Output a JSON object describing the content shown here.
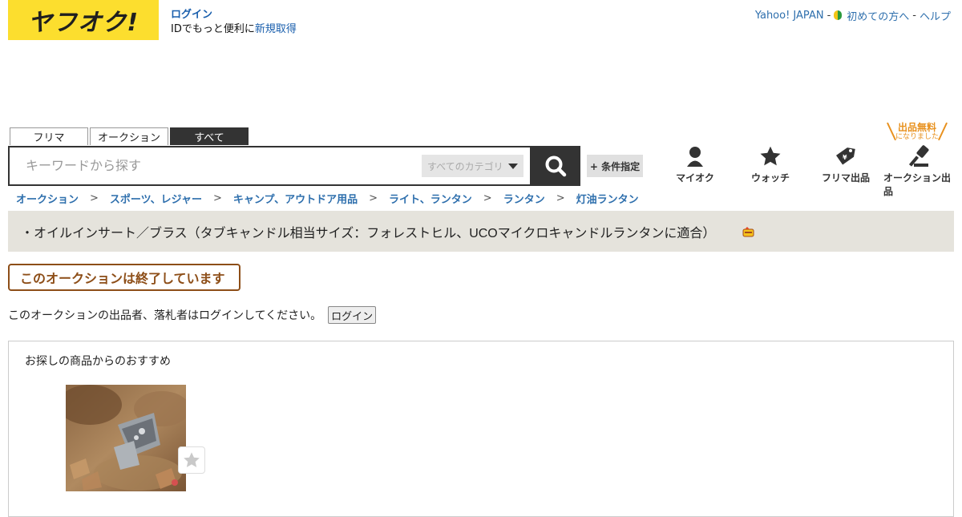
{
  "header": {
    "logo_text": "ヤフオク!",
    "login_label": "ログイン",
    "id_text": "IDでもっと便利に",
    "register_label": "新規取得",
    "top_links": {
      "yahoo": "Yahoo! JAPAN",
      "sep1": "-",
      "beginner": "初めての方へ",
      "sep2": "-",
      "help": "ヘルプ"
    }
  },
  "search": {
    "tabs": [
      "フリマ",
      "オークション",
      "すべて"
    ],
    "active_tab": "すべて",
    "placeholder": "キーワードから探す",
    "category_label": "すべてのカテゴリ",
    "condition_label": "+ 条件指定"
  },
  "free_badge": {
    "line1": "出品無料",
    "line2": "になりました"
  },
  "nav": {
    "myauc": "マイオク",
    "watch": "ウォッチ",
    "flea_sell": "フリマ出品",
    "auction_sell": "オークション出品"
  },
  "breadcrumb": {
    "items": [
      "オークション",
      "スポーツ、レジャー",
      "キャンプ、アウトドア用品",
      "ライト、ランタン",
      "ランタン",
      "灯油ランタン"
    ],
    "separator": ">"
  },
  "item": {
    "title": "・オイルインサート／ブラス（タブキャンドル相当サイズ：フォレストヒル、UCOマイクロキャンドルランタンに適合）"
  },
  "status": {
    "ended_label": "このオークションは終了しています",
    "login_note": "このオークションの出品者、落札者はログインしてください。",
    "login_button": "ログイン"
  },
  "recommend": {
    "title": "お探しの商品からのおすすめ"
  },
  "colors": {
    "logo_bg": "#fcde2e",
    "link": "#1a5fad",
    "title_bar_bg": "#e5e3dc",
    "ended_border": "#8d4e18",
    "free_badge": "#e8911e"
  }
}
